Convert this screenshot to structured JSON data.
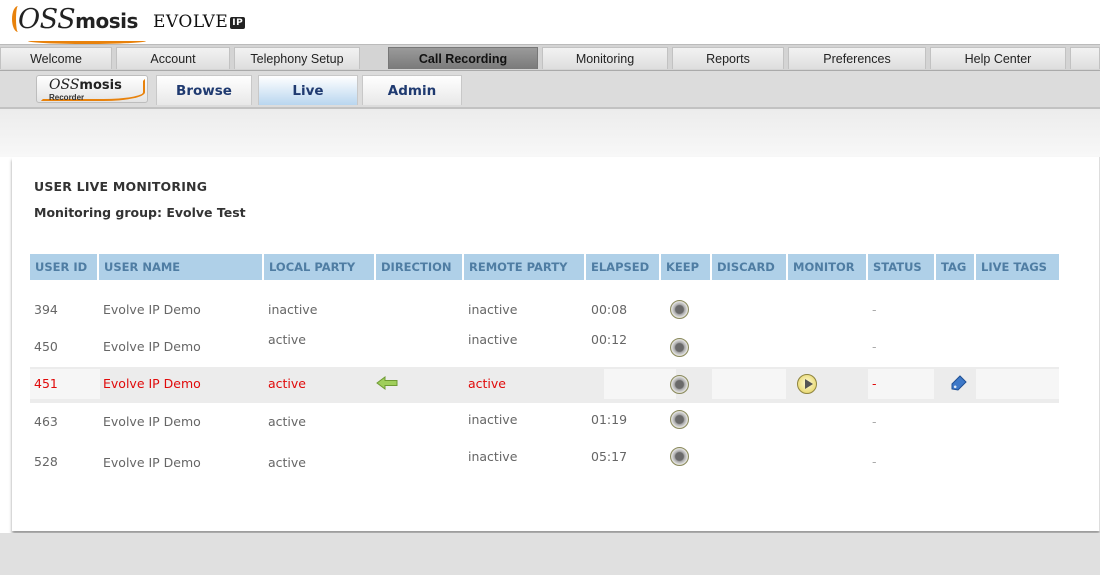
{
  "brand": {
    "logo_os": "OSS",
    "logo_mosis": "mosis",
    "evolve": "EVOLVE",
    "evolve_badge": "IP"
  },
  "main_nav": [
    "Welcome",
    "Account",
    "Telephony Setup",
    "Call Recording",
    "Monitoring",
    "Reports",
    "Preferences",
    "Help Center"
  ],
  "main_nav_active": "Call Recording",
  "recorder_logo": {
    "oss": "OSS",
    "mosis": "mosis",
    "sub": "Recorder"
  },
  "sub_nav": [
    "Browse",
    "Live",
    "Admin"
  ],
  "sub_nav_active": "Live",
  "page": {
    "title": "USER LIVE MONITORING",
    "group": "Monitoring group: Evolve Test"
  },
  "table": {
    "columns": [
      "USER ID",
      "USER NAME",
      "LOCAL PARTY",
      "DIRECTION",
      "REMOTE PARTY",
      "ELAPSED",
      "KEEP",
      "DISCARD",
      "MONITOR",
      "STATUS",
      "TAG",
      "LIVE TAGS"
    ],
    "rows": [
      {
        "user_id": "394",
        "user_name": "Evolve IP Demo",
        "local_party": "inactive",
        "remote_party": "inactive",
        "elapsed": "00:08",
        "status": "-"
      },
      {
        "user_id": "450",
        "user_name": "Evolve IP Demo",
        "local_party": "active",
        "remote_party": "inactive",
        "elapsed": "00:12",
        "status": "-"
      },
      {
        "user_id": "451",
        "user_name": "Evolve IP Demo",
        "local_party": "active",
        "remote_party": "active",
        "elapsed": "",
        "status": "-"
      },
      {
        "user_id": "463",
        "user_name": "Evolve IP Demo",
        "local_party": "active",
        "remote_party": "inactive",
        "elapsed": "01:19",
        "status": "-"
      },
      {
        "user_id": "528",
        "user_name": "Evolve IP Demo",
        "local_party": "active",
        "remote_party": "inactive",
        "elapsed": "05:17",
        "status": "-"
      }
    ],
    "highlighted_row": "451"
  },
  "colors": {
    "header_bg": "#afd0e8",
    "header_text": "#4f7da3",
    "active_row_text": "#e00a0a",
    "brand_orange": "#e8820c"
  }
}
